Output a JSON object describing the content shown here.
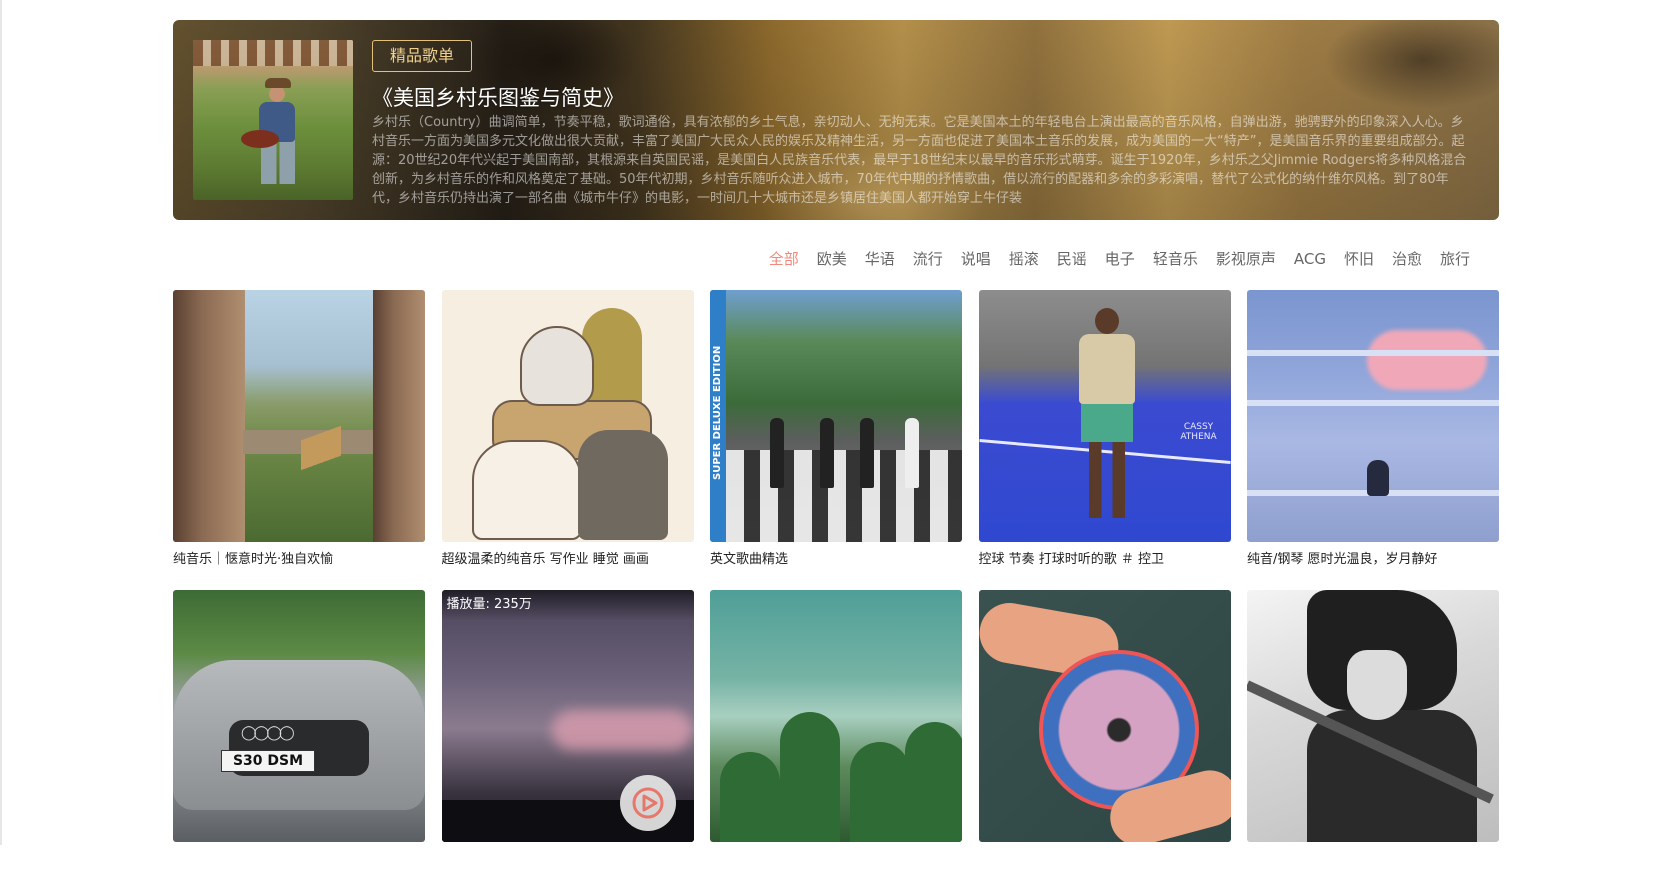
{
  "banner": {
    "tag": "精品歌单",
    "title": "《美国乡村乐图鉴与简史》",
    "description": "乡村乐（Country）曲调简单，节奏平稳，歌词通俗，具有浓郁的乡土气息，亲切动人、无拘无束。它是美国本土的年轻电台上演出最高的音乐风格，自弹出游，驰骋野外的印象深入人心。乡村音乐一方面为美国多元文化做出很大贡献，丰富了美国广大民众人民的娱乐及精神生活，另一方面也促进了美国本土音乐的发展，成为美国的一大“特产”，是美国音乐界的重要组成部分。起源：20世纪20年代兴起于美国南部，其根源来自英国民谣，是美国白人民族音乐代表，最早于18世纪末以最早的音乐形式萌芽。诞生于1920年，乡村乐之父Jimmie Rodgers将多种风格混合创新，为乡村音乐的作和风格奠定了基础。50年代初期，乡村音乐随听众进入城市，70年代中期的抒情歌曲，借以流行的配器和多余的多彩演唱，替代了公式化的纳什维尔风格。到了80年代，乡村音乐仍持出演了一部名曲《城市牛仔》的电影，一时间几十大城市还是乡镇居住美国人都开始穿上牛仔装"
  },
  "tabs": [
    "全部",
    "欧美",
    "华语",
    "流行",
    "说唱",
    "摇滚",
    "民谣",
    "电子",
    "轻音乐",
    "影视原声",
    "ACG",
    "怀旧",
    "治愈",
    "旅行"
  ],
  "active_tab": "全部",
  "playlists": [
    {
      "title": "纯音乐｜惬意时光·独自欢愉"
    },
    {
      "title": "超级温柔的纯音乐 写作业 睡觉 画画"
    },
    {
      "title": "英文歌曲精选",
      "cover_text": "SUPER DELUXE EDITION"
    },
    {
      "title": "控球 节奏 打球时听的歌 ＃ 控卫",
      "cover_text": "CASSY ATHENA"
    },
    {
      "title": "纯音/钢琴 愿时光温良，岁月静好"
    },
    {
      "title": "",
      "cover_text": "S30 DSM"
    },
    {
      "title": "",
      "playcount": "播放量: 235万"
    },
    {
      "title": ""
    },
    {
      "title": ""
    },
    {
      "title": ""
    }
  ],
  "colors": {
    "accent": "#f08a7e",
    "tag_border": "#e5c07b",
    "text": "#222222",
    "tab_text": "#666666"
  },
  "icons": {
    "play": "play-circle-icon"
  }
}
